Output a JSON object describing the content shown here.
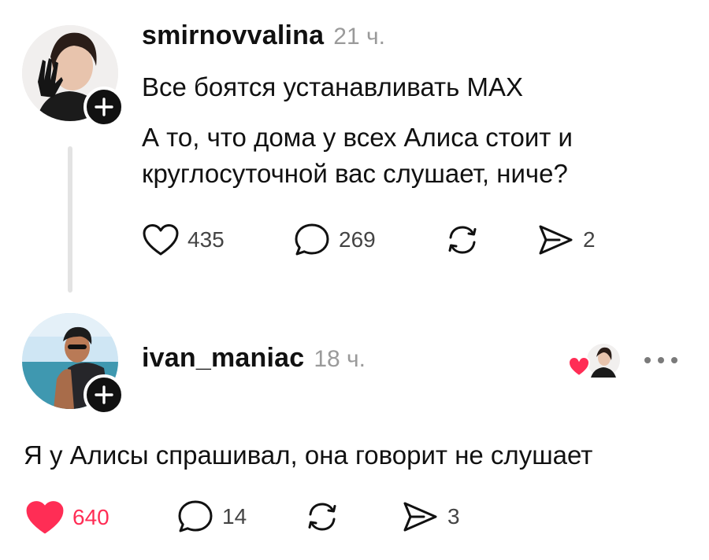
{
  "post": {
    "username": "smirnovvalina",
    "time": "21 ч.",
    "text_line1": "Все боятся устанавливать MAX",
    "text_line2": "А то, что дома у всех Алиса стоит и",
    "text_line3": "круглосуточной вас слушает, ниче?",
    "likes": "435",
    "comments": "269",
    "shares": "2"
  },
  "reply": {
    "username": "ivan_maniac",
    "time": "18 ч.",
    "text": "Я у Алисы спрашивал, она говорит не слушает",
    "likes": "640",
    "comments": "14",
    "shares": "3"
  },
  "colors": {
    "like_active": "#ff2d55",
    "text": "#111111",
    "muted": "#9a9a9a",
    "thread_line": "#e3e3e3"
  },
  "icons": [
    "heart-icon",
    "comment-icon",
    "repost-icon",
    "send-icon",
    "plus-icon",
    "more-icon"
  ]
}
